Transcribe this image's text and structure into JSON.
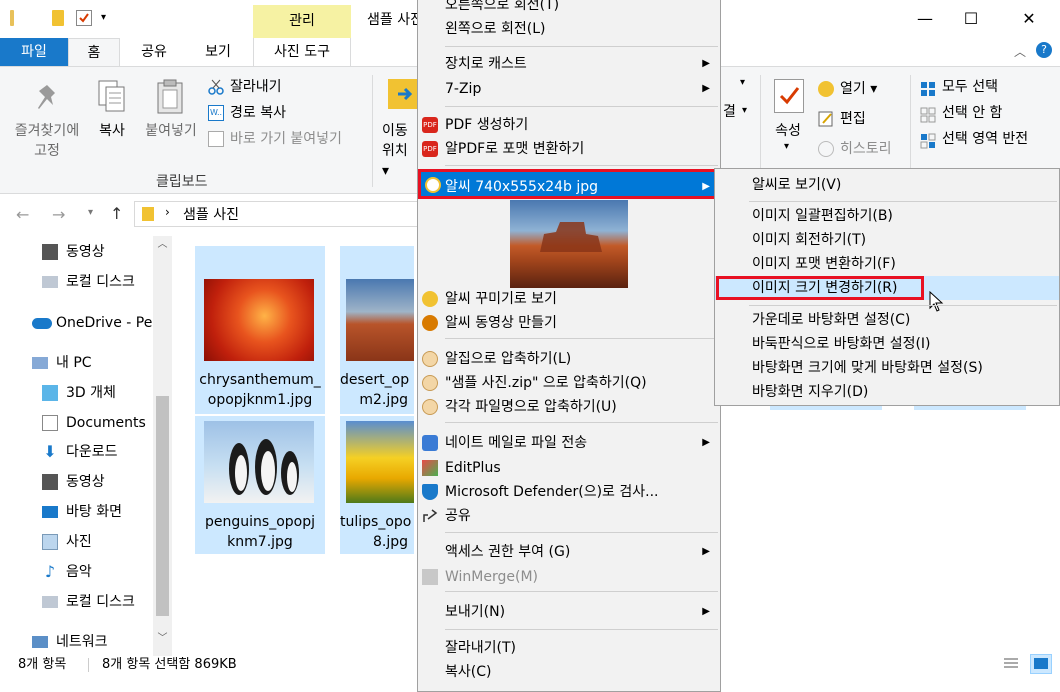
{
  "title_bar": {
    "contextual_tab": "관리",
    "window_title": "샘플 사진",
    "minimize_symbol": "—",
    "maximize_symbol": "☐",
    "close_symbol": "✕"
  },
  "tabs": [
    "파일",
    "홈",
    "공유",
    "보기",
    "사진 도구"
  ],
  "ribbon": {
    "pin_label": "즐겨찾기에\n고정",
    "copy_label": "복사",
    "paste_label": "붙여넣기",
    "cut_label": "잘라내기",
    "copy_path_label": "경로 복사",
    "paste_shortcut_label": "바로 가기 붙여넣기",
    "clipboard_group": "클립보드",
    "move_label": "이동\n위치 ▾",
    "properties_label": "속성",
    "open_label": "열기 ▾",
    "edit_label": "편집",
    "history_label": "히스토리",
    "select_all_label": "모두 선택",
    "select_none_label": "선택 안 함",
    "invert_selection_label": "선택 영역 반전",
    "partial_label": "결"
  },
  "address": {
    "path_folder": "샘플 사진"
  },
  "nav": {
    "items": [
      {
        "label": "동영상",
        "icon": "video-icon"
      },
      {
        "label": "로컬 디스크",
        "icon": "drive-icon"
      },
      {
        "label": "OneDrive - Pe",
        "icon": "onedrive-icon"
      },
      {
        "label": "내 PC",
        "icon": "pc-icon"
      },
      {
        "label": "3D 개체",
        "icon": "cube-icon"
      },
      {
        "label": "Documents",
        "icon": "documents-icon"
      },
      {
        "label": "다운로드",
        "icon": "download-icon"
      },
      {
        "label": "동영상",
        "icon": "video-icon"
      },
      {
        "label": "바탕 화면",
        "icon": "desktop-icon"
      },
      {
        "label": "사진",
        "icon": "pictures-icon"
      },
      {
        "label": "음악",
        "icon": "music-icon"
      },
      {
        "label": "로컬 디스크",
        "icon": "drive-icon"
      },
      {
        "label": "네트워크",
        "icon": "network-icon"
      }
    ]
  },
  "files": [
    {
      "name": "chrysanthemum_\nopopjknm1.jpg"
    },
    {
      "name": "desert_op\nm2.jpg"
    },
    {
      "name": "penguins_opopj\nknm7.jpg"
    },
    {
      "name": "tulips_opo\n8.jpg"
    }
  ],
  "status": {
    "count": "8개 항목",
    "selected": "8개 항목 선택함 869KB"
  },
  "context_menu": {
    "items": [
      {
        "label": "오른쪽으로 회전(T)"
      },
      {
        "label": "왼쪽으로 회전(L)"
      },
      {
        "label": "장치로 캐스트"
      },
      {
        "label": "7-Zip"
      },
      {
        "label": "PDF 생성하기"
      },
      {
        "label": "알PDF로 포맷 변환하기"
      },
      {
        "label": "알씨 740x555x24b jpg"
      },
      {
        "label": "알씨 꾸미기로 보기"
      },
      {
        "label": "알씨 동영상 만들기"
      },
      {
        "label": "알집으로 압축하기(L)"
      },
      {
        "label": "\"샘플 사진.zip\" 으로 압축하기(Q)"
      },
      {
        "label": "각각 파일명으로 압축하기(U)"
      },
      {
        "label": "네이트 메일로 파일 전송"
      },
      {
        "label": "EditPlus"
      },
      {
        "label": "Microsoft Defender(으)로 검사..."
      },
      {
        "label": "공유"
      },
      {
        "label": "액세스 권한 부여 (G)"
      },
      {
        "label": "WinMerge(M)"
      },
      {
        "label": "보내기(N)"
      },
      {
        "label": "잘라내기(T)"
      },
      {
        "label": "복사(C)"
      }
    ]
  },
  "submenu": {
    "items": [
      {
        "label": "알씨로 보기(V)"
      },
      {
        "label": "이미지 일괄편집하기(B)"
      },
      {
        "label": "이미지 회전하기(T)"
      },
      {
        "label": "이미지 포맷 변환하기(F)"
      },
      {
        "label": "이미지 크기 변경하기(R)"
      },
      {
        "label": "가운데로 바탕화면 설정(C)"
      },
      {
        "label": "바둑판식으로 바탕화면 설정(I)"
      },
      {
        "label": "바탕화면 크기에 맞게 바탕화면 설정(S)"
      },
      {
        "label": "바탕화면 지우기(D)"
      }
    ]
  },
  "colors": {
    "file_tab": "#1979ca",
    "selection": "#cce8ff",
    "menu_highlight": "#0078d7",
    "highlight_box": "#e81123",
    "contextual_tab": "#f6f2a3"
  }
}
